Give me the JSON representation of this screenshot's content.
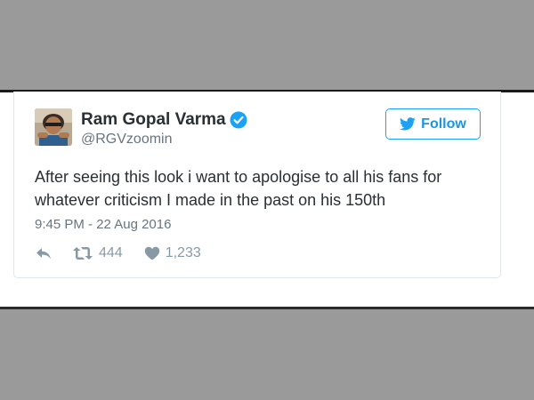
{
  "tweet": {
    "author": {
      "name": "Ram Gopal Varma",
      "handle": "@RGVzoomin",
      "verified": true
    },
    "follow_label": "Follow",
    "text_lines": [
      "After seeing this look i want to apologise to all his fans for",
      "whatever criticism I made in the past on his 150th"
    ],
    "timestamp": "9:45 PM - 22 Aug 2016",
    "retweet_count": "444",
    "like_count": "1,233"
  },
  "colors": {
    "accent": "#1da1f2",
    "text": "#292f33",
    "secondary_text": "#66757f",
    "icon": "#8899a6",
    "background_band": "#9a9a9a"
  },
  "icons": {
    "reply": "reply-icon",
    "retweet": "retweet-icon",
    "like": "heart-icon",
    "verified": "verified-badge-icon",
    "follow": "twitter-bird-icon"
  }
}
